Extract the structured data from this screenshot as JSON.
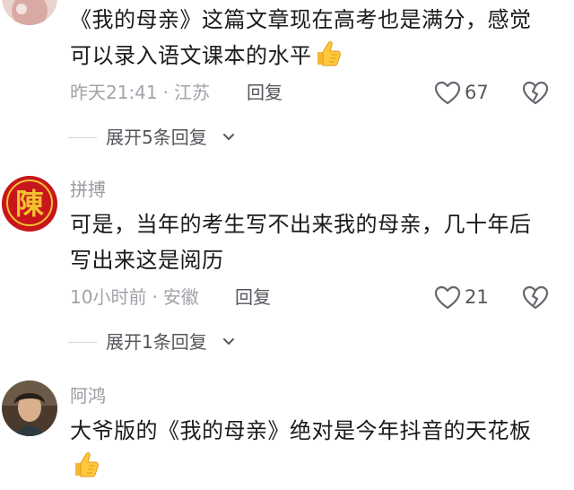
{
  "comments": [
    {
      "username": "",
      "text_line1": "《我的母亲》这篇文章现在高考也是满分，感觉",
      "text_line2": "可以录入语文课本的水平",
      "time": "昨天21:41",
      "location": "江苏",
      "reply_label": "回复",
      "likes": "67",
      "expand_label": "展开5条回复"
    },
    {
      "username": "拼搏",
      "avatar_char": "陳",
      "text_line1": "可是，当年的考生写不出来我的母亲，几十年后",
      "text_line2": "写出来这是阅历",
      "time": "10小时前",
      "location": "安徽",
      "reply_label": "回复",
      "likes": "21",
      "expand_label": "展开1条回复"
    },
    {
      "username": "阿鸿",
      "text_line1": "大爷版的《我的母亲》绝对是今年抖音的天花板"
    }
  ],
  "meta_separator": "·",
  "colors": {
    "text": "#1a1a1a",
    "meta": "#a2a2aa",
    "action": "#55555c",
    "seal_red": "#c8161d",
    "seal_gold": "#f2c230"
  },
  "icons": [
    "thumbs-up-emoji",
    "heart-outline-icon",
    "broken-heart-icon",
    "chevron-down-icon"
  ]
}
